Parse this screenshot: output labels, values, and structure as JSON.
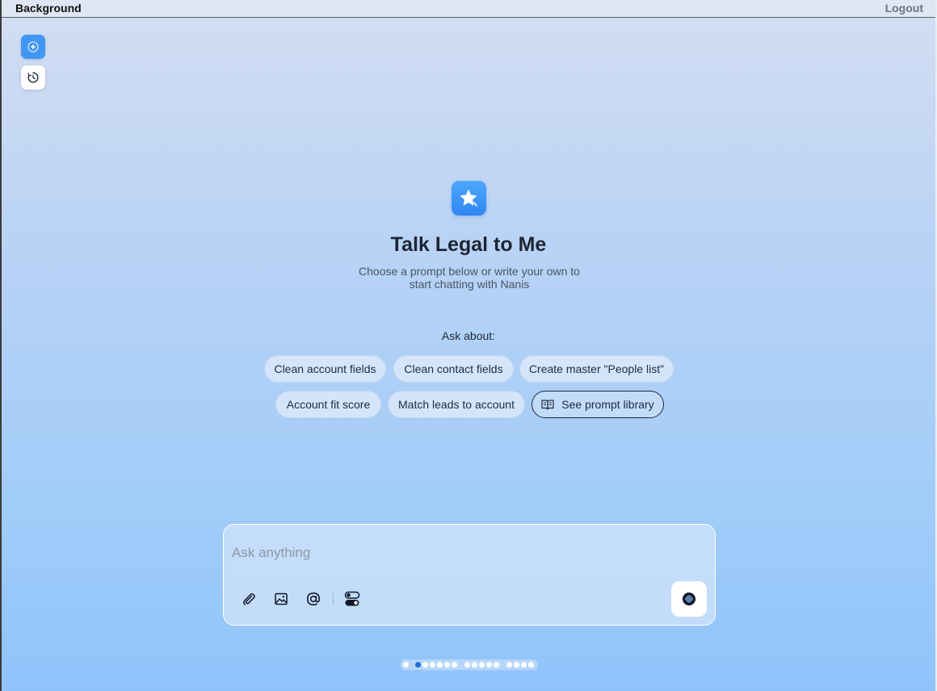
{
  "topbar": {
    "title": "Background",
    "logout": "Logout"
  },
  "sidebar": {
    "new_chat_icon": "plus-circle-icon",
    "history_icon": "history-clock-icon"
  },
  "hero": {
    "logo_icon": "sparkle-star-icon",
    "title": "Talk Legal to Me",
    "subtitle": "Choose a prompt below or write your own to start chatting with Nanis"
  },
  "suggestions": {
    "heading": "Ask about:",
    "row1": [
      "Clean account fields",
      "Clean contact fields",
      "Create master \"People list\""
    ],
    "row2": [
      "Account fit score",
      "Match leads to account"
    ],
    "library": {
      "label": "See prompt library",
      "icon": "book-open-icon"
    }
  },
  "composer": {
    "placeholder": "Ask anything",
    "tools": [
      "paperclip-icon",
      "image-icon",
      "at-sign-icon",
      "toggle-settings-icon"
    ],
    "voice_icon": "voice-waveform-icon"
  },
  "pager": {
    "count": 17,
    "active_index": 1
  },
  "colors": {
    "accent": "#3f97f2",
    "title": "#1e2533",
    "active_dot": "#1f6fd6"
  }
}
